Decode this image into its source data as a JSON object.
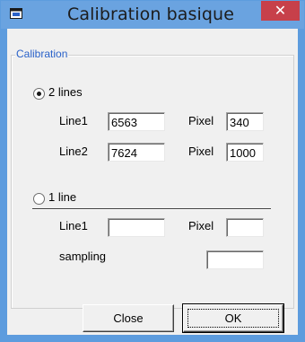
{
  "window": {
    "title": "Calibration basique",
    "close_glyph": "✕"
  },
  "group": {
    "label": "Calibration"
  },
  "two_lines": {
    "radio_label": "2 lines",
    "selected": true,
    "line1_label": "Line1",
    "line1_value": "6563",
    "pixel1_label": "Pixel",
    "pixel1_value": "340",
    "line2_label": "Line2",
    "line2_value": "7624",
    "pixel2_label": "Pixel",
    "pixel2_value": "1000"
  },
  "one_line": {
    "radio_label": "1 line",
    "selected": false,
    "line1_label": "Line1",
    "line1_value": "",
    "pixel_label": "Pixel",
    "pixel_value": "",
    "sampling_label": "sampling",
    "sampling_value": ""
  },
  "buttons": {
    "close_label": "Close",
    "ok_label": "OK"
  },
  "icons": {
    "app": "window-app-icon",
    "close": "close-icon"
  }
}
